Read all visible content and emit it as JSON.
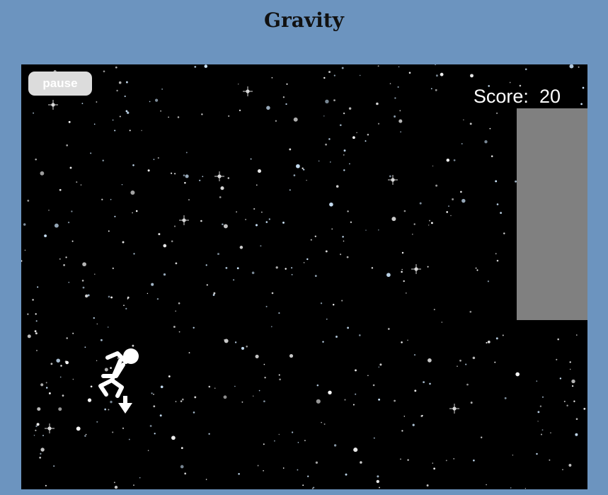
{
  "header": {
    "title": "Gravity"
  },
  "game": {
    "pause_label": "pause",
    "score_label": "Score:",
    "score_value": "20",
    "gravity_direction": "down",
    "colors": {
      "page_background": "#6c94bf",
      "canvas_background": "#000000",
      "obstacle": "#808080",
      "button": "#dcdcdc",
      "text": "#ffffff"
    },
    "icons": {
      "player": "stick-figure-falling-icon",
      "gravity": "arrow-down-icon"
    }
  }
}
